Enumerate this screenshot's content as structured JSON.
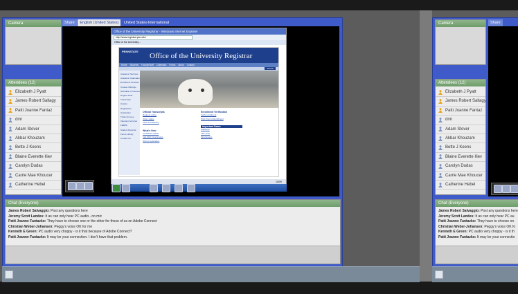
{
  "left": {
    "pods": {
      "cameras_title": "Camera",
      "share_title": "Share",
      "attendees_title": "Attendees (12)",
      "chat_title": "Chat (Everyone)"
    },
    "share_tabs": [
      "English (United States)",
      "United States-International"
    ],
    "attendees": [
      {
        "name": "Elizabeth J Pyatt",
        "role": "host"
      },
      {
        "name": "James Robert Sallagy",
        "role": "host"
      },
      {
        "name": "Patti Joanne Fantaz",
        "role": "host"
      },
      {
        "name": "dmi",
        "role": "participant"
      },
      {
        "name": "Adam Stover",
        "role": "participant"
      },
      {
        "name": "Akbar Khouzam",
        "role": "participant"
      },
      {
        "name": "Bette J Keens",
        "role": "participant"
      },
      {
        "name": "Blaine Everette Iliev",
        "role": "participant"
      },
      {
        "name": "Carolyn Dudas",
        "role": "participant"
      },
      {
        "name": "Carrie Mae Khoucer",
        "role": "participant"
      },
      {
        "name": "Catherine Hebel",
        "role": "participant"
      }
    ],
    "chat": [
      {
        "who": "James Robert Salvaggio:",
        "msg": "Post any questions here"
      },
      {
        "who": "Jeremy Scott Landes:",
        "msg": "It as can only hear PC audio...no mic"
      },
      {
        "who": "Patti Joanne Fantazko:",
        "msg": "They have to choose one or the other for those of us on Adobe Connect"
      },
      {
        "who": "Christian Weber-Johansen:",
        "msg": "Peggy's voice OK for me"
      },
      {
        "who": "Kenneth E Green:",
        "msg": "PC audio very choppy - is it that because of Adobe Connect?"
      },
      {
        "who": "Patti Joanne Fantazko:",
        "msg": "It may be your connection. I don't have that problem."
      }
    ]
  },
  "browser": {
    "window_title": "Office of the University Registrar - Windows Internet Explorer",
    "address": "http://www.registrar.psu.edu/",
    "tab": "Office of the University...",
    "site_title": "Office of the University Registrar",
    "site_logo": "PENNSTATE",
    "nav_items": [
      "Home",
      "Students",
      "Faculty/Staff",
      "Calendars",
      "Forms",
      "About",
      "Contact"
    ],
    "search_label": "Search",
    "left_menu": [
      "Academic Services",
      "Academic Calendars",
      "Enrollment Services",
      "Course Offerings",
      "Schedule of Courses",
      "Degree Audit",
      "Transcripts",
      "Grades",
      "Registration",
      "Graduation",
      "Tuition & Fees",
      "Veterans Services",
      "FERPA",
      "Student Records",
      "Forms Library",
      "Contact Us"
    ],
    "mid_col_title": "Official Transcripts",
    "mid_col_links": [
      "Request online",
      "Order status",
      "Fees and delivery"
    ],
    "mid_col_title2": "What's New",
    "mid_col_links2": [
      "LionPATH update",
      "Fall 2010 Final Exams",
      "Spring registration"
    ],
    "right_col_title": "Enrollment Verification",
    "right_col_links": [
      "Verify enrollment",
      "Print Proof of Enrollment"
    ],
    "right_col_title2": "Important Dates",
    "right_col_links2": [
      "Add/Drop",
      "Late Drop",
      "Final Exams"
    ],
    "zoom": "100%"
  },
  "right": {
    "pods": {
      "cameras_title": "Camera",
      "share_title": "Share",
      "attendees_title": "Attendees (12)",
      "chat_title": "Chat (Everyone)"
    },
    "attendees": [
      "Elizabeth J Pyatt",
      "James Robert Sallagy",
      "Patti Joanne Fantaz",
      "dmi",
      "Adam Stover",
      "Akbar Khouzam",
      "Bette J Keens",
      "Blaine Everette Iliev",
      "Carolyn Dudas",
      "Carrie Mae Khoucer",
      "Catherine Hebel"
    ],
    "chat": [
      {
        "who": "James Robert Salvaggio:",
        "msg": "Post any questions here"
      },
      {
        "who": "Jeremy Scott Landes:",
        "msg": "It as can only hear PC au"
      },
      {
        "who": "Patti Joanne Fantazko:",
        "msg": "They have to choose on"
      },
      {
        "who": "Christian Weber-Johansen:",
        "msg": "Peggy's voice OK fo"
      },
      {
        "who": "Kenneth E Green:",
        "msg": "PC audio very choppy - is it th"
      },
      {
        "who": "Patti Joanne Fantazko:",
        "msg": "It may be your connectio"
      }
    ]
  },
  "colors": {
    "frame": "#3f5bc9",
    "pod_header": "#7aa676",
    "host_icon": "#e8a21c",
    "participant_icon": "#7a93bf"
  }
}
